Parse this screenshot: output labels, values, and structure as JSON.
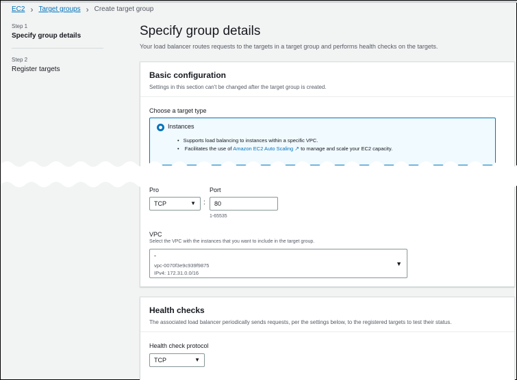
{
  "breadcrumb": {
    "items": [
      "EC2",
      "Target groups"
    ],
    "current": "Create target group"
  },
  "steps": [
    {
      "label": "Step 1",
      "title": "Specify group details"
    },
    {
      "label": "Step 2",
      "title": "Register targets"
    }
  ],
  "header": {
    "title": "Specify group details",
    "description": "Your load balancer routes requests to the targets in a target group and performs health checks on the targets."
  },
  "basic_config": {
    "title": "Basic configuration",
    "subtitle": "Settings in this section can't be changed after the target group is created.",
    "target_type_label": "Choose a target type",
    "selected_option": "Instances",
    "bullets": {
      "b1": "Supports load balancing to instances within a specific VPC.",
      "b2_prefix": "Facilitates the use of",
      "b2_link": "Amazon EC2 Auto Scaling",
      "b2_suffix": "to manage and scale your EC2 capacity."
    },
    "protocol_label": "Pro",
    "protocol_value": "TCP",
    "port_label": "Port",
    "port_value": "80",
    "port_hint": "1-65535",
    "vpc_label": "VPC",
    "vpc_hint": "Select the VPC with the instances that you want to include in the target group.",
    "vpc_name": "-",
    "vpc_id": "vpc-0070f3e9c939f9875",
    "vpc_cidr": "IPv4: 172.31.0.0/16"
  },
  "health_checks": {
    "title": "Health checks",
    "subtitle": "The associated load balancer periodically sends requests, per the settings below, to the registered targets to test their status.",
    "protocol_label": "Health check protocol",
    "protocol_value": "TCP"
  },
  "colors": {
    "accent": "#0073bb",
    "background": "#f2f3f3",
    "selected_bg": "#f1faff"
  }
}
